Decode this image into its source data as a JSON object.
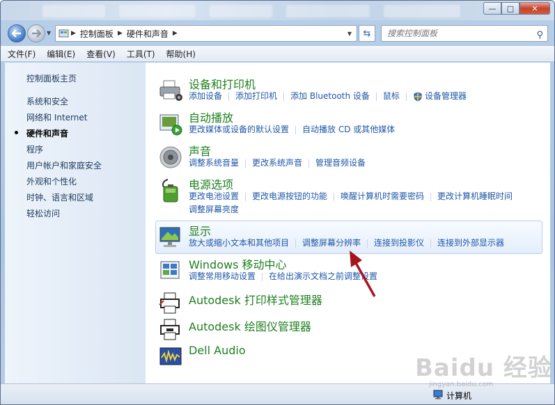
{
  "window": {
    "controls": {
      "minimize": "—",
      "maximize": "□",
      "close": "✕"
    }
  },
  "nav": {
    "back_icon": "back-arrow-icon",
    "forward_icon": "forward-arrow-icon",
    "breadcrumb": [
      "控制面板",
      "硬件和声音"
    ],
    "search_placeholder": "搜索控制面板"
  },
  "menu": [
    "文件(F)",
    "编辑(E)",
    "查看(V)",
    "工具(T)",
    "帮助(H)"
  ],
  "sidebar": {
    "items": [
      {
        "label": "控制面板主页",
        "active": false
      },
      {
        "label": "系统和安全",
        "active": false
      },
      {
        "label": "网络和 Internet",
        "active": false
      },
      {
        "label": "硬件和声音",
        "active": true
      },
      {
        "label": "程序",
        "active": false
      },
      {
        "label": "用户帐户和家庭安全",
        "active": false
      },
      {
        "label": "外观和个性化",
        "active": false
      },
      {
        "label": "时钟、语言和区域",
        "active": false
      },
      {
        "label": "轻松访问",
        "active": false
      }
    ]
  },
  "categories": [
    {
      "title": "设备和打印机",
      "icon": "printer-icon",
      "links": [
        "添加设备",
        "添加打印机",
        "添加 Bluetooth 设备",
        "鼠标",
        "设备管理器"
      ],
      "links2": []
    },
    {
      "title": "自动播放",
      "icon": "autoplay-icon",
      "links": [
        "更改媒体或设备的默认设置",
        "自动播放 CD 或其他媒体"
      ],
      "links2": []
    },
    {
      "title": "声音",
      "icon": "speaker-icon",
      "links": [
        "调整系统音量",
        "更改系统声音",
        "管理音频设备"
      ],
      "links2": []
    },
    {
      "title": "电源选项",
      "icon": "battery-icon",
      "links": [
        "更改电池设置",
        "更改电源按钮的功能",
        "唤醒计算机时需要密码",
        "更改计算机睡眠时间"
      ],
      "links2": [
        "调整屏幕亮度"
      ]
    },
    {
      "title": "显示",
      "icon": "monitor-icon",
      "links": [
        "放大或缩小文本和其他项目",
        "调整屏幕分辨率",
        "连接到投影仪",
        "连接到外部显示器"
      ],
      "links2": []
    },
    {
      "title": "Windows 移动中心",
      "icon": "mobility-center-icon",
      "links": [
        "调整常用移动设置",
        "在给出演示文档之前调整设置"
      ],
      "links2": []
    },
    {
      "title": "Autodesk 打印样式管理器",
      "icon": "autodesk-print-icon",
      "links": [],
      "links2": []
    },
    {
      "title": "Autodesk 绘图仪管理器",
      "icon": "autodesk-plotter-icon",
      "links": [],
      "links2": []
    },
    {
      "title": "Dell Audio",
      "icon": "dell-audio-icon",
      "links": [],
      "links2": []
    }
  ],
  "status": {
    "computer_label": "计算机"
  },
  "watermark": {
    "brand": "Baidu 经验",
    "url": "jingyan.baidu.com"
  },
  "colors": {
    "title_green": "#1e7f1e",
    "link_blue": "#1f57a8",
    "annotation_arrow": "#a8141b"
  }
}
